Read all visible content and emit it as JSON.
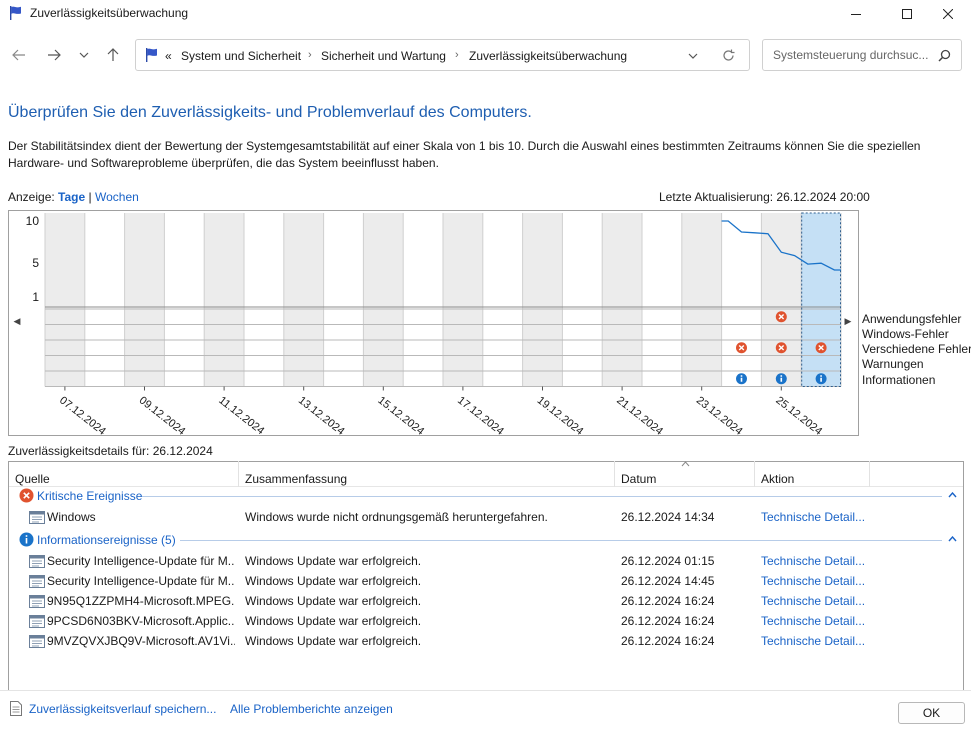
{
  "window": {
    "title": "Zuverlässigkeitsüberwachung"
  },
  "address": {
    "prefix": "«",
    "crumbs": [
      "System und Sicherheit",
      "Sicherheit und Wartung",
      "Zuverlässigkeitsüberwachung"
    ]
  },
  "search": {
    "placeholder": "Systemsteuerung durchsuc..."
  },
  "heading": "Überprüfen Sie den Zuverlässigkeits- und Problemverlauf des Computers.",
  "description": "Der Stabilitätsindex dient der Bewertung der Systemgesamtstabilität auf einer Skala von 1 bis 10. Durch die Auswahl eines bestimmten Zeitraums können Sie die speziellen Hardware- und Softwareprobleme überprüfen, die das System beeinflusst haben.",
  "view": {
    "label": "Anzeige:",
    "days": "Tage",
    "divider": "|",
    "weeks": "Wochen"
  },
  "last_update": "Letzte Aktualisierung: 26.12.2024 20:00",
  "chart_data": {
    "type": "line",
    "yticks": [
      "10",
      "5",
      "1"
    ],
    "ylim": [
      1,
      10
    ],
    "xlabels": [
      "07.12.2024",
      "09.12.2024",
      "11.12.2024",
      "13.12.2024",
      "15.12.2024",
      "17.12.2024",
      "19.12.2024",
      "21.12.2024",
      "23.12.2024",
      "25.12.2024"
    ],
    "selected_day": "26.12.2024",
    "stability_index": [
      {
        "day": "24.12.2024",
        "values": [
          10,
          8.7,
          8.6
        ]
      },
      {
        "day": "25.12.2024",
        "values": [
          8.5,
          6.3,
          5.9
        ]
      },
      {
        "day": "26.12.2024",
        "values": [
          4.9,
          5.0,
          4.2
        ]
      }
    ],
    "event_rows": [
      "Anwendungsfehler",
      "Windows-Fehler",
      "Verschiedene Fehler",
      "Warnungen",
      "Informationen"
    ],
    "events": [
      {
        "day": "25.12.2024",
        "row": "Anwendungsfehler",
        "kind": "error"
      },
      {
        "day": "24.12.2024",
        "row": "Verschiedene Fehler",
        "kind": "error"
      },
      {
        "day": "25.12.2024",
        "row": "Verschiedene Fehler",
        "kind": "error"
      },
      {
        "day": "26.12.2024",
        "row": "Verschiedene Fehler",
        "kind": "error"
      },
      {
        "day": "24.12.2024",
        "row": "Informationen",
        "kind": "info"
      },
      {
        "day": "25.12.2024",
        "row": "Informationen",
        "kind": "info"
      },
      {
        "day": "26.12.2024",
        "row": "Informationen",
        "kind": "info"
      }
    ],
    "colors": {
      "line": "#1a73c9",
      "error": "#e0532f",
      "info": "#1a73c9",
      "selected": "#c5e0f5"
    }
  },
  "details": {
    "label": "Zuverlässigkeitsdetails für: 26.12.2024"
  },
  "table": {
    "headers": {
      "source": "Quelle",
      "summary": "Zusammenfassung",
      "date": "Datum",
      "action": "Aktion"
    },
    "groups": [
      {
        "title": "Kritische Ereignisse",
        "icon": "error-icon",
        "rows": [
          {
            "source": "Windows",
            "summary": "Windows wurde nicht ordnungsgemäß heruntergefahren.",
            "date": "26.12.2024 14:34",
            "action": "Technische Detail..."
          }
        ]
      },
      {
        "title": "Informationsereignisse (5)",
        "icon": "info-icon",
        "rows": [
          {
            "source": "Security Intelligence-Update für M...",
            "summary": "Windows Update war erfolgreich.",
            "date": "26.12.2024 01:15",
            "action": "Technische Detail..."
          },
          {
            "source": "Security Intelligence-Update für M...",
            "summary": "Windows Update war erfolgreich.",
            "date": "26.12.2024 14:45",
            "action": "Technische Detail..."
          },
          {
            "source": "9N95Q1ZZPMH4-Microsoft.MPEG...",
            "summary": "Windows Update war erfolgreich.",
            "date": "26.12.2024 16:24",
            "action": "Technische Detail..."
          },
          {
            "source": "9PCSD6N03BKV-Microsoft.Applic...",
            "summary": "Windows Update war erfolgreich.",
            "date": "26.12.2024 16:24",
            "action": "Technische Detail..."
          },
          {
            "source": "9MVZQVXJBQ9V-Microsoft.AV1Vi...",
            "summary": "Windows Update war erfolgreich.",
            "date": "26.12.2024 16:24",
            "action": "Technische Detail..."
          }
        ]
      }
    ]
  },
  "footer": {
    "save_link": "Zuverlässigkeitsverlauf speichern...",
    "reports_link": "Alle Problemberichte anzeigen",
    "ok": "OK"
  }
}
